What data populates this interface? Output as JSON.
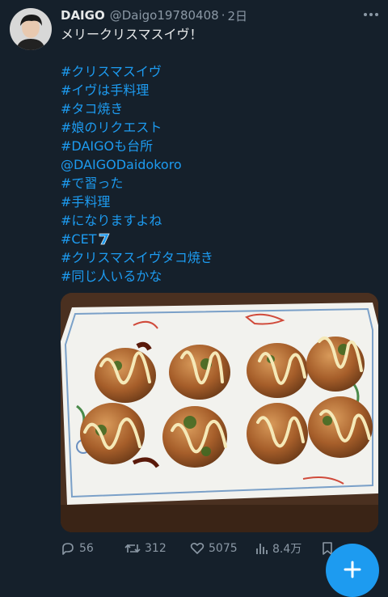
{
  "tweet": {
    "author_name": "DAIGO",
    "handle": "@Daigo19780408",
    "separator": "·",
    "time": "2日",
    "text": "メリークリスマスイヴ！",
    "hashtags": [
      "#クリスマスイヴ",
      "#イヴは手料理",
      "#タコ焼き",
      "#娘のリクエスト",
      "#DAIGOも台所",
      "@DAIGODaidokoro",
      "#で習った",
      "#手料理",
      "#になりますよね",
      "#CET",
      "#クリスマスイヴタコ焼き",
      "#同じ人いるかな"
    ]
  },
  "actions": {
    "replies": "56",
    "retweets": "312",
    "likes": "5075",
    "views": "8.4万"
  },
  "colors": {
    "background": "#15202b",
    "link": "#1d9bf0",
    "muted": "#8b98a5",
    "text": "#e7e9ea"
  },
  "icons": [
    "more-icon",
    "reply-icon",
    "retweet-icon",
    "like-icon",
    "views-icon",
    "bookmark-icon",
    "compose-plus-icon"
  ]
}
